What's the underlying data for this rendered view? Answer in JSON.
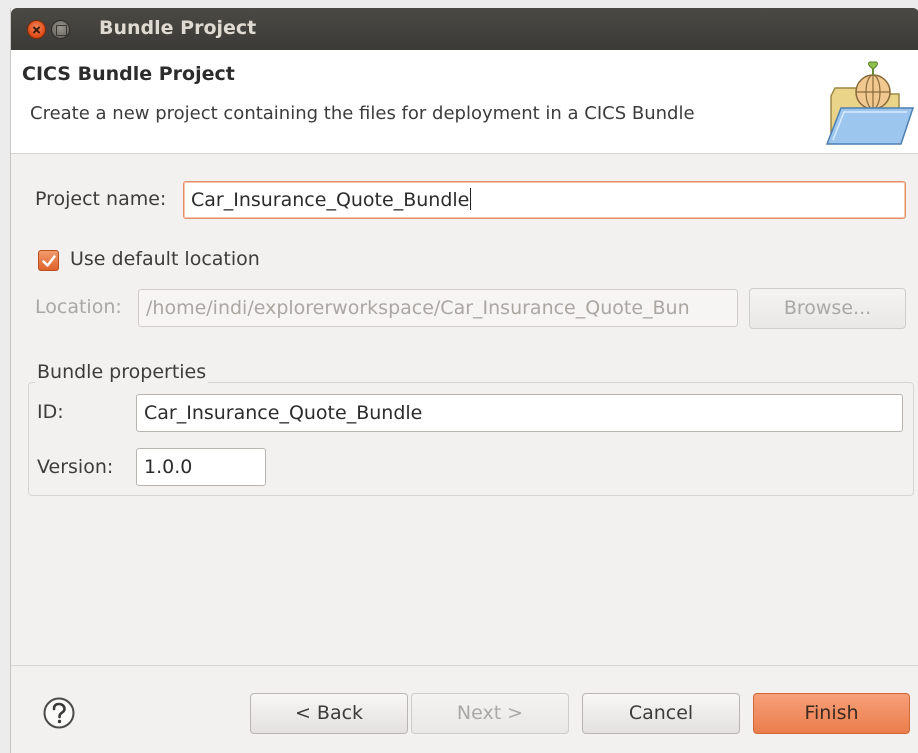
{
  "window": {
    "title": "Bundle Project"
  },
  "banner": {
    "title": "CICS Bundle Project",
    "description": "Create a new project containing the files for deployment in a CICS Bundle",
    "icon": "folder-with-globe-icon"
  },
  "form": {
    "project_name_label": "Project name:",
    "project_name_value": "Car_Insurance_Quote_Bundle",
    "use_default_location_label": "Use default location",
    "use_default_location_checked": true,
    "location_label": "Location:",
    "location_value": "/home/indi/explorerworkspace/Car_Insurance_Quote_Bun",
    "browse_label": "Browse..."
  },
  "bundle_properties": {
    "group_title": "Bundle properties",
    "id_label": "ID:",
    "id_value": "Car_Insurance_Quote_Bundle",
    "version_label": "Version:",
    "version_value": "1.0.0"
  },
  "footer": {
    "help_icon": "question-mark-icon",
    "back_label": "< Back",
    "next_label": "Next >",
    "cancel_label": "Cancel",
    "finish_label": "Finish"
  },
  "colors": {
    "accent": "#e9753f",
    "titlebar": "#3c3b37",
    "banner_bg": "#ffffff",
    "window_bg": "#f2f1f0"
  }
}
